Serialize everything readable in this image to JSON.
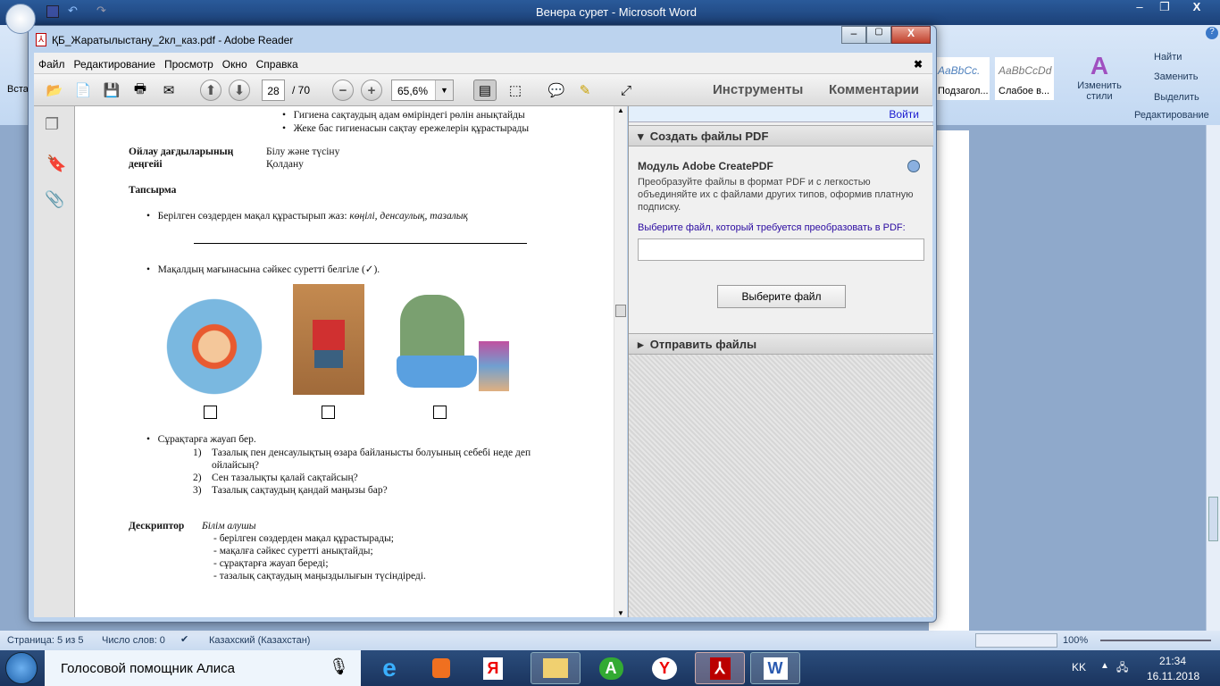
{
  "word": {
    "title": "Венера сурет - Microsoft Word",
    "ribbon": {
      "paste": "Вставить",
      "style1": "AaBbCc.",
      "style1_name": "Подзагол...",
      "style2": "AaBbCcDd",
      "style2_name": "Слабое в...",
      "change_styles": "Изменить стили",
      "find": "Найти",
      "replace": "Заменить",
      "select": "Выделить",
      "editing_group": "Редактирование"
    },
    "status": {
      "page": "Страница: 5 из 5",
      "words": "Число слов: 0",
      "language": "Казахский (Казахстан)",
      "zoom": "100%"
    }
  },
  "reader": {
    "title": "ҚБ_Жаратылыстану_2кл_каз.pdf - Adobe Reader",
    "menu": [
      "Файл",
      "Редактирование",
      "Просмотр",
      "Окно",
      "Справка"
    ],
    "toolbar": {
      "page": "28",
      "total": "/ 70",
      "zoom": "65,6%",
      "tools": "Инструменты",
      "comments": "Комментарии"
    },
    "panel": {
      "login": "Войти",
      "create_header": "Создать файлы PDF",
      "module_title": "Модуль Adobe CreatePDF",
      "description": "Преобразуйте файлы в формат PDF и с легкостью объединяйте их с файлами других типов, оформив платную подписку.",
      "choose_label": "Выберите файл, который требуется преобразовать в PDF:",
      "file_value": "",
      "choose_button": "Выберите файл",
      "send_header": "Отправить файлы"
    },
    "doc": {
      "bullets_top": [
        "Гигиена сақтаудың адам өміріндегі рөлін анықтайды",
        "Жеке бас гигиенасын сақтау ережелерін құрастырады"
      ],
      "skills_label_1": "Ойлау дағдыларының",
      "skills_label_2": "деңгейі",
      "skills_value_1": "Білу және түсіну",
      "skills_value_2": "Қолдану",
      "task_heading": "Тапсырма",
      "task1": "Берілген сөздерден мақал құрастырып жаз: ",
      "task1_words": "көңілі, денсаулық, тазалық",
      "task2": "Мақалдың мағынасына сәйкес суретті белгіле (✓).",
      "task3": "Сұрақтарға жауап бер.",
      "questions": [
        "1)",
        "Тазалық пен денсаулықтың өзара байланысты болуының себебі неде деп",
        "ойлайсың?",
        "2)",
        "Сен тазалықты қалай сақтайсың?",
        "3)",
        "Тазалық сақтаудың қандай маңызы бар?"
      ],
      "descriptor_label": "Дескриптор",
      "descriptor_subject": "Білім алушы",
      "descriptors": [
        "-  берілген сөздерден мақал құрастырады;",
        "-  мақалға сәйкес суретті анықтайды;",
        "-  сұрақтарға жауап береді;",
        "-  тазалық сақтаудың маңыздылығын түсіндіреді."
      ]
    }
  },
  "taskbar": {
    "assistant": "Голосовой помощник Алиса",
    "lang": "KK",
    "time": "21:34",
    "date": "16.11.2018",
    "apps": [
      "ie-icon",
      "media-icon",
      "yandex-icon",
      "explorer-icon",
      "a-icon",
      "yandex-browser-icon",
      "adobe-reader-icon",
      "word-icon"
    ]
  }
}
